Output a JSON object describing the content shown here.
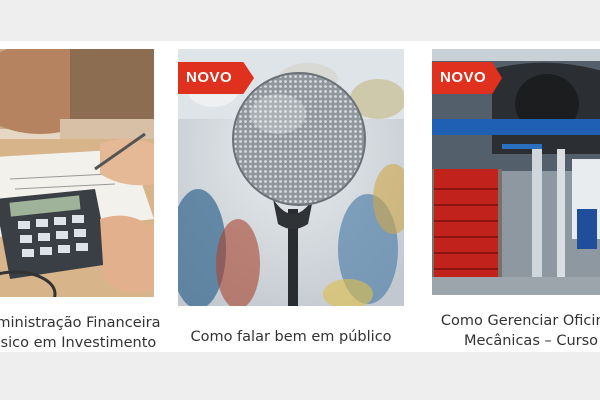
{
  "courses": [
    {
      "badge": "",
      "title_line1": "Administração Financeira",
      "title_line2": "Básico em Investimento",
      "image": "calculator-finance-photo"
    },
    {
      "badge": "NOVO",
      "title_line1": "Como falar bem em público",
      "title_line2": "",
      "image": "microphone-photo"
    },
    {
      "badge": "NOVO",
      "title_line1": "Como Gerenciar Oficinas",
      "title_line2": "Mecânicas – Curso",
      "image": "auto-workshop-photo"
    }
  ],
  "colors": {
    "badge": "#e0301e",
    "title_text": "#333333",
    "page_bg": "#eeeeee"
  }
}
